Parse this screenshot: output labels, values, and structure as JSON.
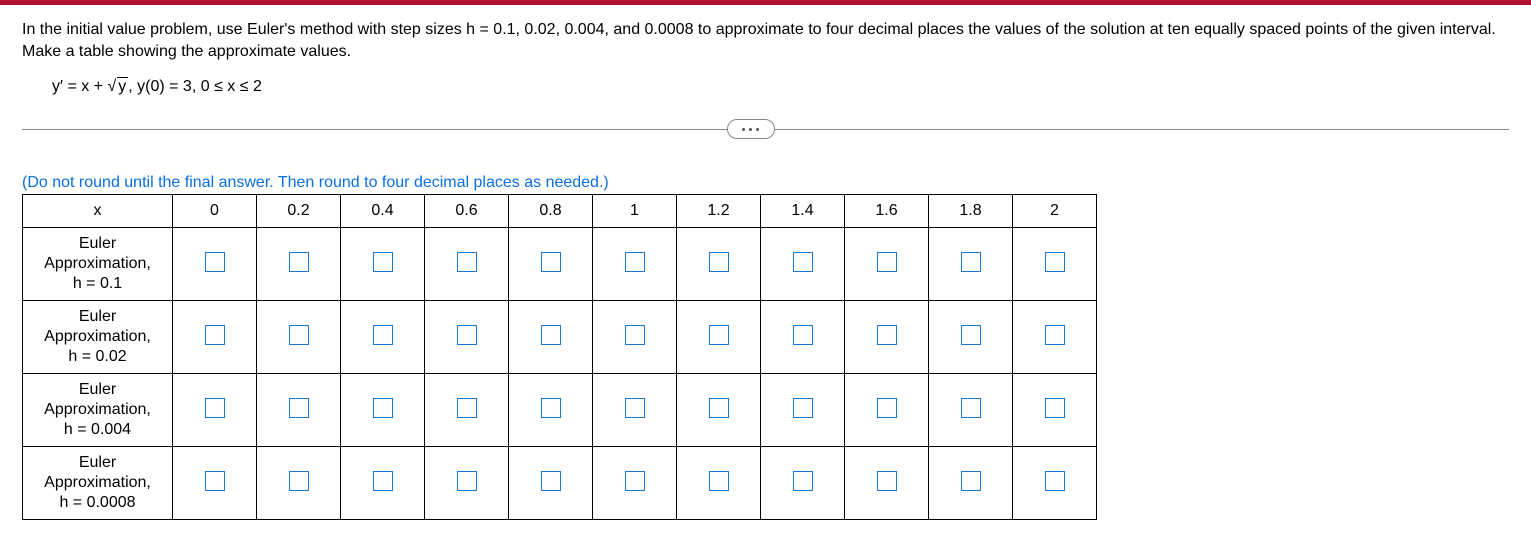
{
  "colors": {
    "topbar": "#b01030",
    "link": "#0a6fe0",
    "inputBorder": "#1976d2"
  },
  "prompt": {
    "line1": "In the initial value problem, use Euler's method with step sizes h = 0.1, 0.02, 0.004, and 0.0008 to approximate to four decimal places the values of the solution at ten equally spaced points of the given interval. Make a table showing the approximate values."
  },
  "equation": {
    "part1": "y′ = x + ",
    "sqrt_sym": "√",
    "radicand": "y",
    "part2": ", y(0) = 3, 0 ≤ x ≤ 2"
  },
  "instruction": "(Do not round until the final answer. Then round to four decimal places as needed.)",
  "table": {
    "header_label": "x",
    "x_values": [
      "0",
      "0.2",
      "0.4",
      "0.6",
      "0.8",
      "1",
      "1.2",
      "1.4",
      "1.6",
      "1.8",
      "2"
    ],
    "rows": [
      {
        "label_l1": "Euler",
        "label_l2": "Approximation,",
        "label_l3": "h = 0.1",
        "cells": [
          "",
          "",
          "",
          "",
          "",
          "",
          "",
          "",
          "",
          "",
          ""
        ]
      },
      {
        "label_l1": "Euler",
        "label_l2": "Approximation,",
        "label_l3": "h = 0.02",
        "cells": [
          "",
          "",
          "",
          "",
          "",
          "",
          "",
          "",
          "",
          "",
          ""
        ]
      },
      {
        "label_l1": "Euler",
        "label_l2": "Approximation,",
        "label_l3": "h = 0.004",
        "cells": [
          "",
          "",
          "",
          "",
          "",
          "",
          "",
          "",
          "",
          "",
          ""
        ]
      },
      {
        "label_l1": "Euler",
        "label_l2": "Approximation,",
        "label_l3": "h = 0.0008",
        "cells": [
          "",
          "",
          "",
          "",
          "",
          "",
          "",
          "",
          "",
          "",
          ""
        ]
      }
    ]
  }
}
